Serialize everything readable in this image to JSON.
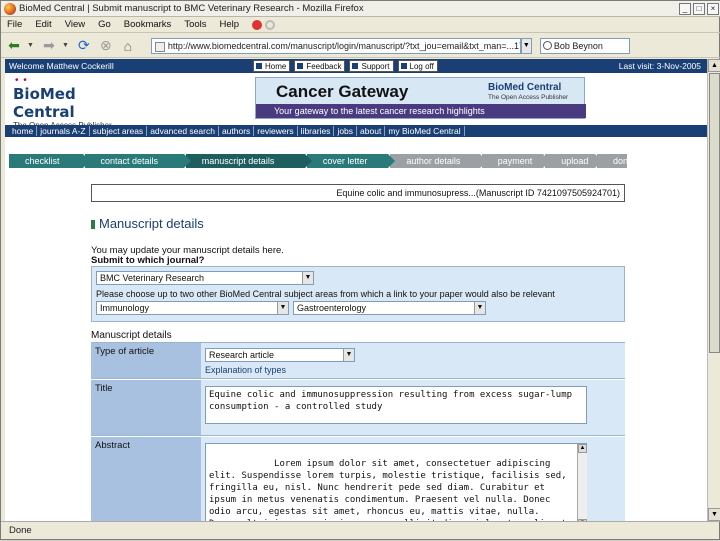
{
  "browser": {
    "window_title": "BioMed Central | Submit manuscript to BMC Veterinary Research - Mozilla Firefox",
    "menu": [
      "File",
      "Edit",
      "View",
      "Go",
      "Bookmarks",
      "Tools",
      "Help"
    ],
    "url": "http://www.biomedcentral.com/manuscript/login/manuscript/?txt_jou=email&txt_man=...1742180756935",
    "search_value": "Bob Beynon",
    "status": "Done"
  },
  "site": {
    "welcome": "Welcome Matthew Cockerill",
    "header_links": [
      "Home",
      "Feedback",
      "Support",
      "Log off"
    ],
    "last_visit": "Last visit: 3-Nov-2005",
    "logo_name": "BioMed Central",
    "logo_tagline": "The Open Access Publisher",
    "banner_title": "Cancer Gateway",
    "banner_tagline": "Your gateway to the latest cancer research highlights",
    "banner_brand": "BioMed Central",
    "banner_brand_sub": "The Open Access Publisher",
    "nav": [
      "home",
      "journals A-Z",
      "subject areas",
      "advanced search",
      "authors",
      "reviewers",
      "libraries",
      "jobs",
      "about",
      "my BioMed Central"
    ]
  },
  "steps": [
    {
      "label": "checklist",
      "state": "done"
    },
    {
      "label": "contact details",
      "state": "done"
    },
    {
      "label": "manuscript details",
      "state": "current"
    },
    {
      "label": "cover letter",
      "state": "done"
    },
    {
      "label": "author details",
      "state": "todo"
    },
    {
      "label": "payment",
      "state": "todo"
    },
    {
      "label": "upload",
      "state": "todo"
    },
    {
      "label": "done",
      "state": "todo"
    }
  ],
  "manuscript": {
    "banner": "Equine colic and immunosupress...(Manuscript ID 7421097505924701)",
    "section_title": "Manuscript details",
    "intro": "You may update your manuscript details here.",
    "journal_heading": "Submit to which journal?",
    "journal_selected": "BMC Veterinary Research",
    "subject_hint": "Please choose up to two other BioMed Central subject areas from which a link to your paper would also be relevant",
    "subject_1": "Immunology",
    "subject_2": "Gastroenterology",
    "details_heading": "Manuscript details",
    "type_label": "Type of article",
    "type_value": "Research article",
    "type_help": "Explanation of types",
    "title_label": "Title",
    "title_value": "Equine colic and immunosuppression resulting from excess sugar-lump consumption - a controlled study",
    "abstract_label": "Abstract",
    "abstract_value": "Lorem ipsum dolor sit amet, consectetuer adipiscing elit. Suspendisse lorem turpis, molestie tristique, facilisis sed, fringilla eu, nisl. Nunc hendrerit pede sed diam. Curabitur et ipsum in metus venenatis condimentum. Praesent vel nulla. Donec odio arcu, egestas sit amet, rhoncus eu, mattis vitae, nulla. Donec ultricies, mauris in ornare sollicitudin, nisl metus aliquet turpis, eget lacinia libero velit feugiat erat. Integer"
  }
}
